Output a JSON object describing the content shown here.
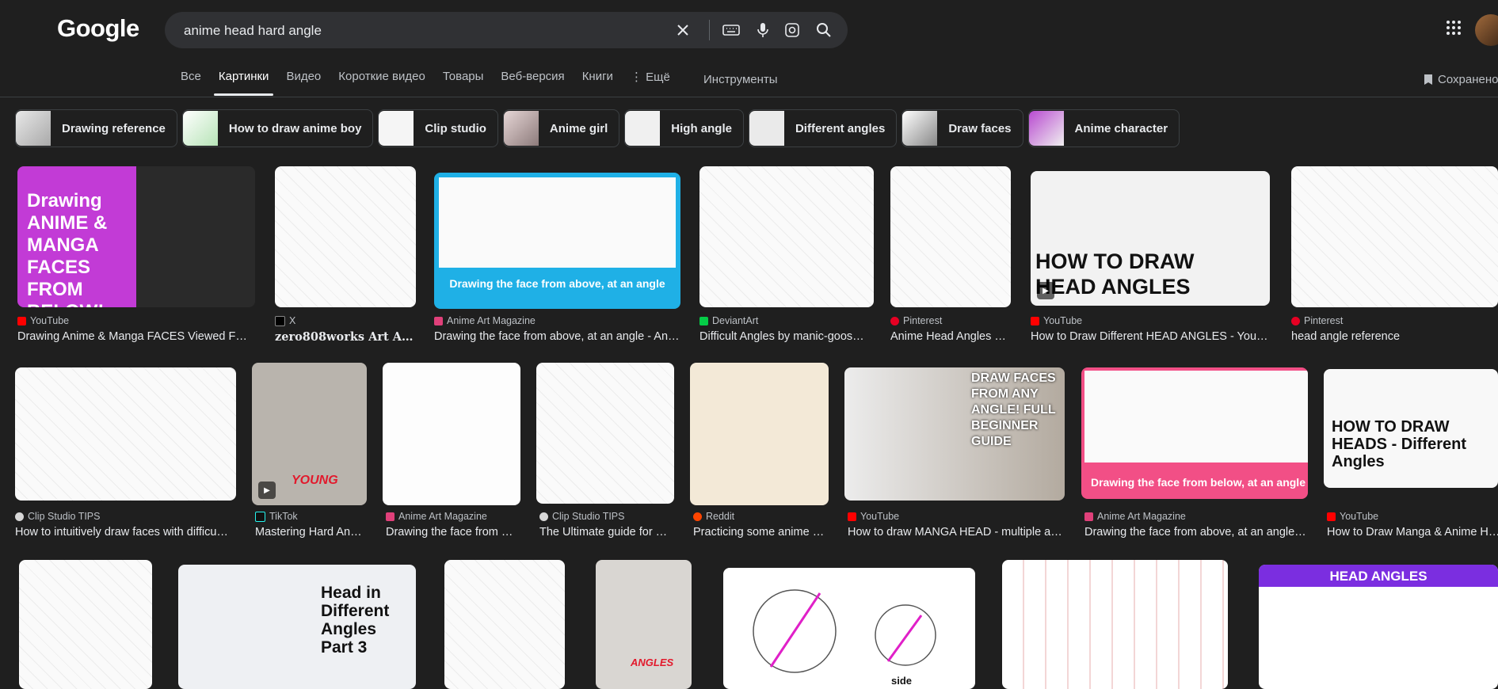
{
  "header": {
    "logo": "Google",
    "search": {
      "value": "anime head hard angle"
    },
    "icons": [
      "clear-icon",
      "keyboard-icon",
      "mic-icon",
      "lens-icon",
      "search-icon",
      "apps-icon"
    ]
  },
  "tabs": [
    {
      "label": "Все",
      "active": false
    },
    {
      "label": "Картинки",
      "active": true
    },
    {
      "label": "Видео",
      "active": false
    },
    {
      "label": "Короткие видео",
      "active": false
    },
    {
      "label": "Товары",
      "active": false
    },
    {
      "label": "Веб-версия",
      "active": false
    },
    {
      "label": "Книги",
      "active": false
    },
    {
      "label": "⋮ Ещё",
      "active": false
    }
  ],
  "tools_label": "Инструменты",
  "saved_label": "Сохранено",
  "chips": [
    "Drawing reference",
    "How to draw anime boy",
    "Clip studio",
    "Anime girl",
    "High angle",
    "Different angles",
    "Draw faces",
    "Anime character"
  ],
  "results": [
    {
      "source": "YouTube",
      "title": "Drawing Anime & Manga FACES Viewed FR…",
      "thumb_text": "Drawing ANIME & MANGA FACES FROM BELOW!"
    },
    {
      "source": "X",
      "title": "zero808works Art Arc…",
      "thumb_text": ""
    },
    {
      "source": "Anime Art Magazine",
      "title": "Drawing the face from above, at an angle - An…",
      "thumb_text": "Drawing the face from above, at an angle"
    },
    {
      "source": "DeviantArt",
      "title": "Difficult Angles by manic-goos…",
      "thumb_text": ""
    },
    {
      "source": "Pinterest",
      "title": "Anime Head Angles …",
      "thumb_text": ""
    },
    {
      "source": "YouTube",
      "title": "How to Draw Different HEAD ANGLES - You…",
      "thumb_text": "HOW TO DRAW HEAD ANGLES"
    },
    {
      "source": "Pinterest",
      "title": "head angle reference",
      "thumb_text": ""
    },
    {
      "source": "Clip Studio TIPS",
      "title": "How to intuitively draw faces with difficu…",
      "thumb_text": ""
    },
    {
      "source": "TikTok",
      "title": "Mastering Hard An…",
      "thumb_text": "YOUNG"
    },
    {
      "source": "Anime Art Magazine",
      "title": "Drawing the face from …",
      "thumb_text": ""
    },
    {
      "source": "Clip Studio TIPS",
      "title": "The Ultimate guide for …",
      "thumb_text": ""
    },
    {
      "source": "Reddit",
      "title": "Practicing some anime …",
      "thumb_text": ""
    },
    {
      "source": "YouTube",
      "title": "How to draw MANGA HEAD - multiple a…",
      "thumb_text": "DRAW FACES FROM ANY ANGLE! FULL BEGINNER GUIDE"
    },
    {
      "source": "Anime Art Magazine",
      "title": "Drawing the face from above, at an angle…",
      "thumb_text": "Drawing the face from below, at an angle"
    },
    {
      "source": "YouTube",
      "title": "How to Draw Manga & Anime H…",
      "thumb_text": "HOW TO DRAW HEADS - Different Angles"
    },
    {
      "source": "",
      "title": "",
      "thumb_text": ""
    },
    {
      "source": "",
      "title": "",
      "thumb_text": "Head in Different Angles Part 3"
    },
    {
      "source": "",
      "title": "",
      "thumb_text": ""
    },
    {
      "source": "",
      "title": "",
      "thumb_text": "ANGLES"
    },
    {
      "source": "",
      "title": "",
      "thumb_text": "side"
    },
    {
      "source": "",
      "title": "",
      "thumb_text": ""
    },
    {
      "source": "",
      "title": "",
      "thumb_text": "HEAD ANGLES"
    }
  ],
  "colors": {
    "background": "#1f1f1f",
    "search_bg": "#303134",
    "text": "#e8eaed",
    "muted": "#bdc1c6"
  }
}
